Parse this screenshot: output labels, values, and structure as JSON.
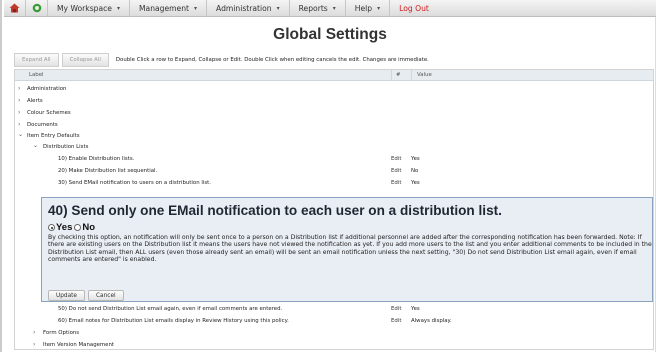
{
  "nav": {
    "items": [
      {
        "label": "My Workspace",
        "caret": "▾"
      },
      {
        "label": "Management",
        "caret": "▾"
      },
      {
        "label": "Administration",
        "caret": "▾"
      },
      {
        "label": "Reports",
        "caret": "▾"
      },
      {
        "label": "Help",
        "caret": "▾"
      }
    ],
    "logout": "Log Out",
    "icons": [
      "home-icon",
      "refresh-icon"
    ]
  },
  "page": {
    "title": "Global Settings"
  },
  "toolbar": {
    "expand_all": "Expand All",
    "collapse_all": "Collapse All",
    "message": "Double Click a row to Expand, Collapse or Edit. Double Click when editing cancels the edit. Changes are immediate."
  },
  "grid": {
    "columns": {
      "label": "Label",
      "num": "#",
      "value": "Value"
    },
    "groups": {
      "administration": "Administration",
      "alerts": "Alerts",
      "colour_schemes": "Colour Schemes",
      "documents": "Documents",
      "item_entry_defaults": "Item Entry Defaults",
      "distribution_lists": "Distribution Lists",
      "form_options": "Form Options",
      "item_version_management": "Item Version Management"
    },
    "settings": [
      {
        "label": "10) Enable Distribution lists.",
        "edit": "Edit",
        "value": "Yes"
      },
      {
        "label": "20) Make Distribution list sequential.",
        "edit": "Edit",
        "value": "No"
      },
      {
        "label": "30) Send EMail notification to users on a distribution list.",
        "edit": "Edit",
        "value": "Yes"
      },
      {
        "label": "50) Do not send Distribution List email again, even if email comments are entered.",
        "edit": "Edit",
        "value": "Yes"
      },
      {
        "label": "60) Email notes for Distribution List emails display in Review History using this policy.",
        "edit": "Edit",
        "value": "Always display."
      }
    ],
    "toggles": {
      "collapsed": "›",
      "expanded": "⌄"
    }
  },
  "editor": {
    "title": "40) Send only one EMail notification to each user on a distribution list.",
    "yes_label": "Yes",
    "no_label": "No",
    "selected": "Yes",
    "description": "By checking this option, an notification will only be sent once to a person on a Distribution list if additional personnel are added after the corresponding notification has been forwarded. Note: If there are existing users on the Distribution list it means the users have not viewed the notification as yet. If you add more users to the list and you enter additional comments to be included in the Distribution List email, then ALL users (even those already sent an email) will be sent an email notification unless the next setting, \"30) Do not send Distribution List email again, even if email comments are entered\" is enabled.",
    "update": "Update",
    "cancel": "Cancel"
  }
}
